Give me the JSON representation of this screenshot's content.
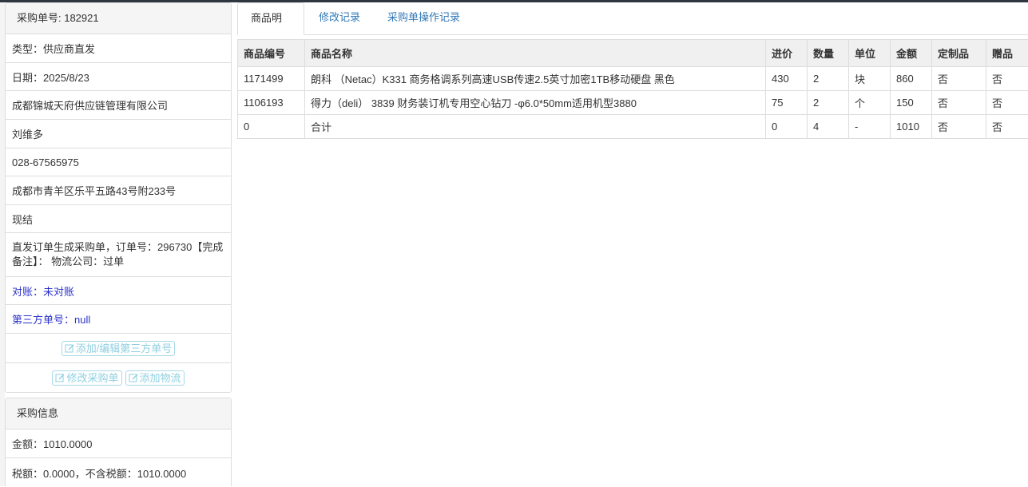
{
  "order_panel": {
    "header": "采购单号: 182921",
    "type_line": "类型：供应商直发",
    "date_line": "日期：2025/8/23",
    "supplier": "成都锦城天府供应链管理有限公司",
    "contact": "刘维多",
    "phone": "028-67565975",
    "address": "成都市青羊区乐平五路43号附233号",
    "settlement": "现结",
    "remark": "直发订单生成采购单，订单号：296730【完成备注】： 物流公司：过单",
    "reconcile": "对账：未对账",
    "third_party": "第三方单号：null",
    "btn_edit_third_party": "添加/编辑第三方单号",
    "btn_modify_order": "修改采购单",
    "btn_add_logistics": "添加物流"
  },
  "info_panel": {
    "header": "采购信息",
    "amount": "金额：1010.0000",
    "tax": "税额：0.0000，不含税额：1010.0000"
  },
  "tabs": [
    {
      "label": "商品明细",
      "active": true
    },
    {
      "label": "修改记录",
      "active": false
    },
    {
      "label": "采购单操作记录",
      "active": false
    }
  ],
  "table": {
    "headers": [
      "商品编号",
      "商品名称",
      "进价",
      "数量",
      "单位",
      "金额",
      "定制品",
      "赠品"
    ],
    "rows": [
      [
        "1171499",
        "朗科 （Netac）K331 商务格调系列高速USB传速2.5英寸加密1TB移动硬盘 黑色",
        "430",
        "2",
        "块",
        "860",
        "否",
        "否"
      ],
      [
        "1106193",
        "得力（deli） 3839 财务装订机专用空心钻刀 -φ6.0*50mm适用机型3880",
        "75",
        "2",
        "个",
        "150",
        "否",
        "否"
      ],
      [
        "0",
        "合计",
        "0",
        "4",
        "-",
        "1010",
        "否",
        "否"
      ]
    ]
  },
  "colors": {
    "link": "#337ab7",
    "status_blue": "#2a32c9",
    "button_outline": "#a8d8e6"
  },
  "icons": {
    "edit": "edit-square-icon"
  }
}
